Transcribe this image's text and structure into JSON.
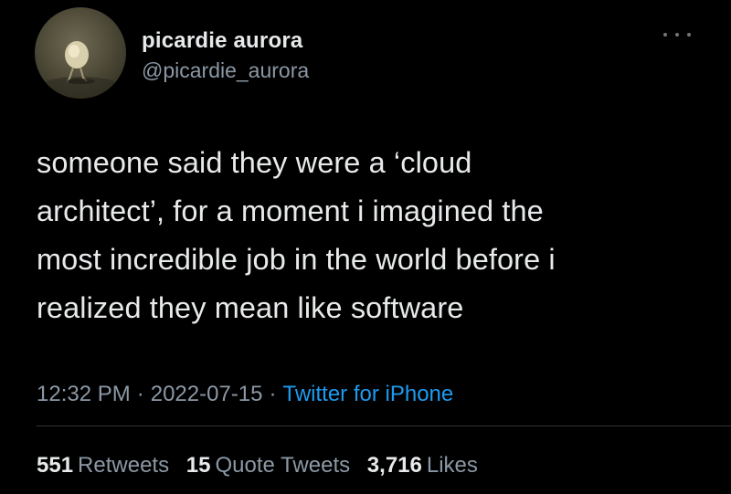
{
  "author": {
    "display_name": "picardie aurora",
    "handle": "@picardie_aurora",
    "avatar_icon": "kiwi-bird-painting-avatar"
  },
  "more_icon": "more-options-icon",
  "tweet": {
    "text": "someone said they were a ‘cloud\narchitect’, for a moment i imagined the\nmost incredible job in the world before i\nrealized they mean like software"
  },
  "meta": {
    "time": "12:32 PM",
    "separator": "·",
    "date": "2022-07-15",
    "source": "Twitter for iPhone"
  },
  "stats": {
    "retweets": {
      "count": "551",
      "label": "Retweets"
    },
    "quote_tweets": {
      "count": "15",
      "label": "Quote Tweets"
    },
    "likes": {
      "count": "3,716",
      "label": "Likes"
    }
  },
  "colors": {
    "background": "#000000",
    "primary_text": "#e7e9ea",
    "secondary_text": "#8b98a5",
    "link": "#1d9bf0",
    "divider": "#2f3336"
  }
}
